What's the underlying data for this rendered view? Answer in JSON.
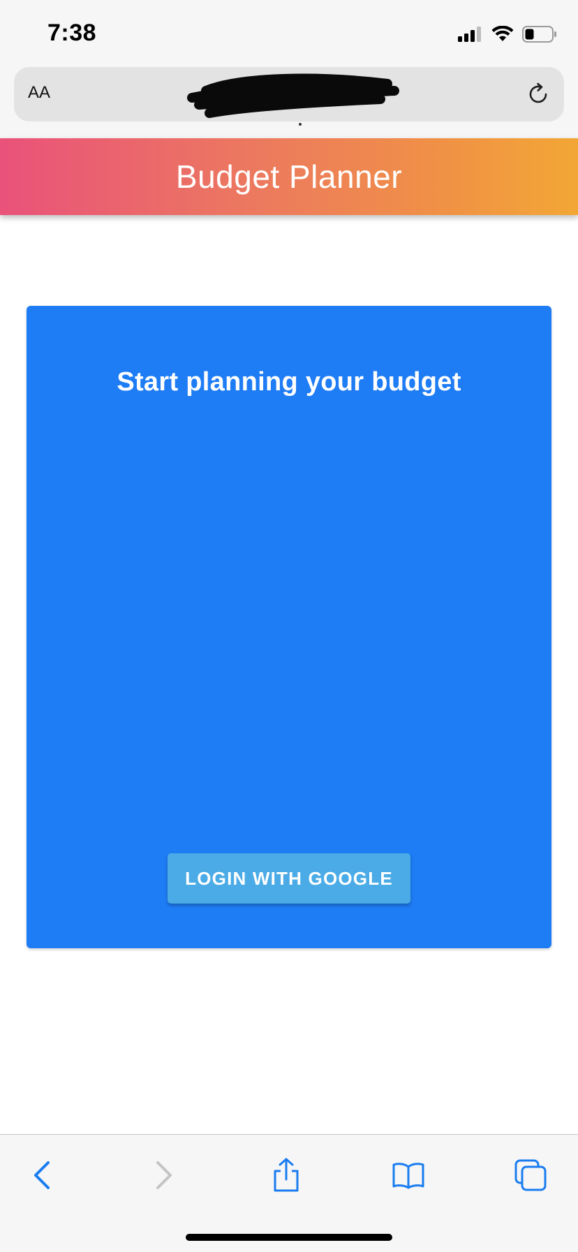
{
  "status_bar": {
    "time": "7:38",
    "icons": [
      "cellular-signal-icon",
      "wifi-icon",
      "battery-icon"
    ]
  },
  "browser": {
    "text_size_label": "AA",
    "url": "",
    "url_redacted": true,
    "reload_icon": "reload-icon"
  },
  "header": {
    "title": "Budget Planner",
    "gradient_start": "#e9527a",
    "gradient_end": "#f2a735"
  },
  "card": {
    "heading": "Start planning your budget",
    "background_color": "#1e7cf5",
    "login_button_label": "LOGIN WITH GOOGLE",
    "login_button_color": "#4aabe6"
  },
  "toolbar": {
    "items": [
      "back-icon",
      "forward-icon",
      "share-icon",
      "bookmarks-icon",
      "tabs-icon"
    ],
    "accent_color": "#1a7cf0",
    "forward_enabled": false
  }
}
